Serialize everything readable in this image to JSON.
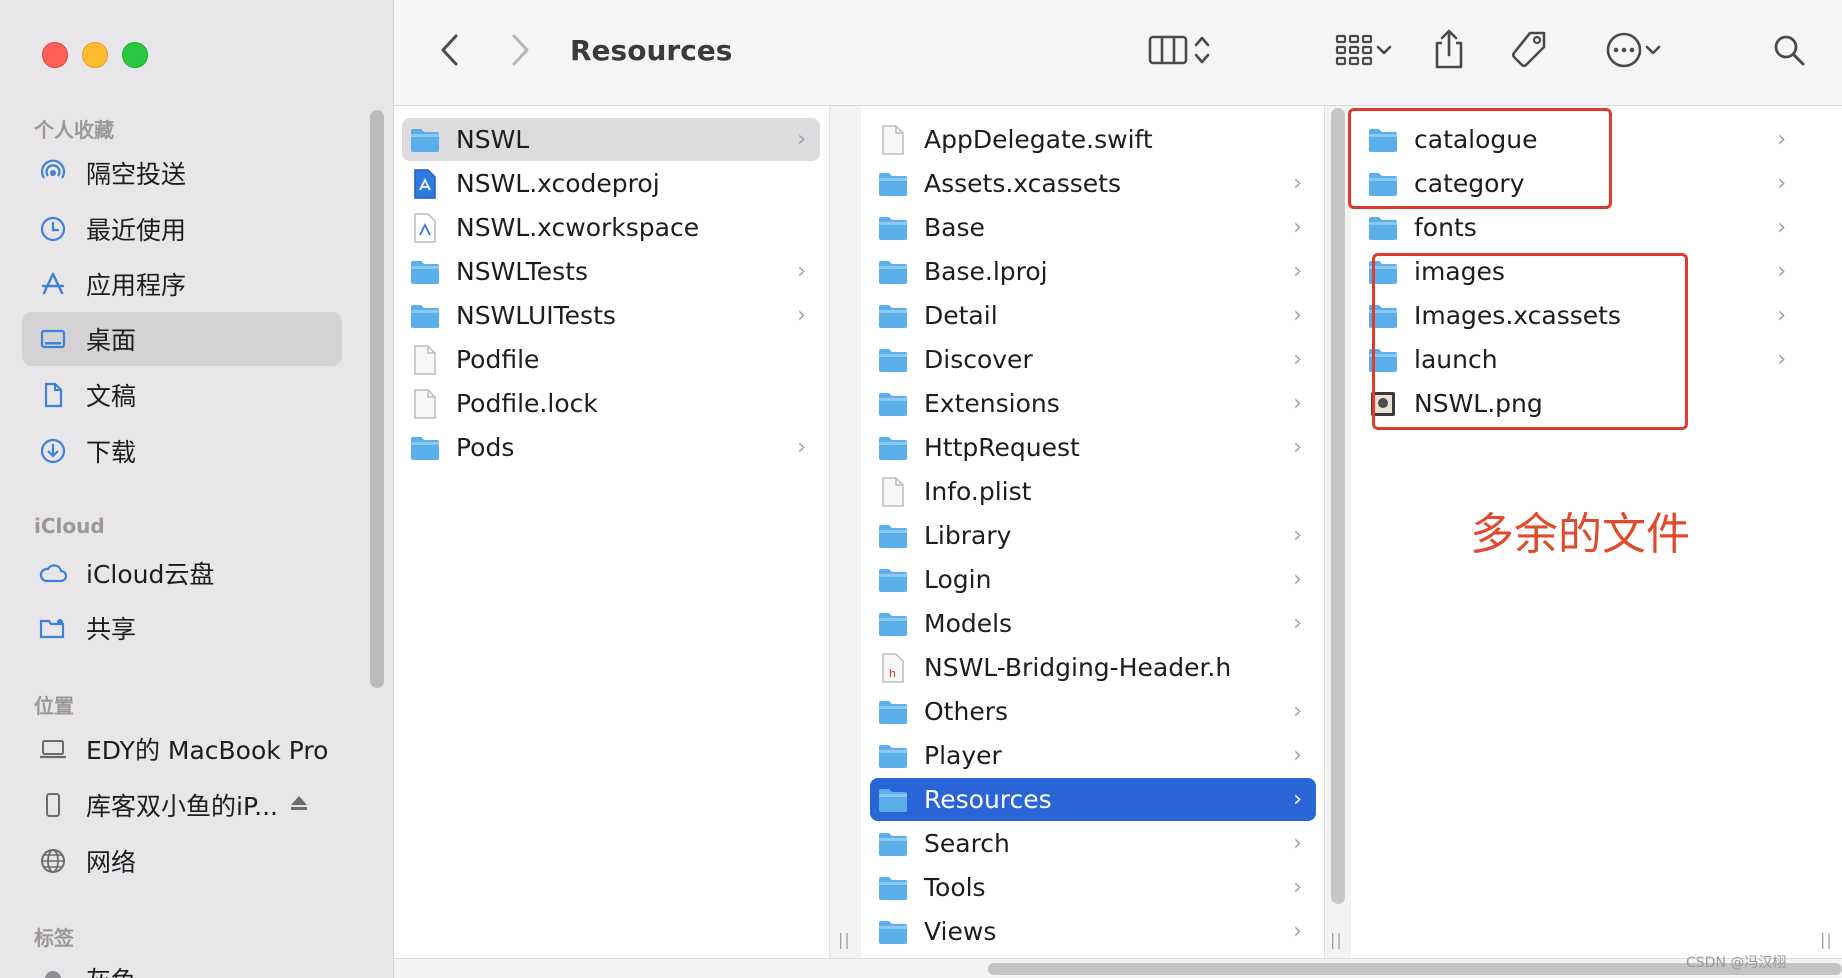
{
  "toolbar": {
    "title": "Resources"
  },
  "sidebar": {
    "sections": {
      "favorites": "个人收藏",
      "icloud": "iCloud",
      "locations": "位置",
      "tags": "标签"
    },
    "favorites": [
      "隔空投送",
      "最近使用",
      "应用程序",
      "桌面",
      "文稿",
      "下载"
    ],
    "icloud": [
      "iCloud云盘",
      "共享"
    ],
    "locations": [
      "EDY的 MacBook Pro",
      "库客双小鱼的iP...",
      "网络"
    ],
    "tags": [
      "灰色"
    ]
  },
  "column1": [
    {
      "name": "NSWL",
      "type": "folder",
      "chevron": true,
      "selected": "gray"
    },
    {
      "name": "NSWL.xcodeproj",
      "type": "xcodeproj",
      "chevron": false
    },
    {
      "name": "NSWL.xcworkspace",
      "type": "xcworkspace",
      "chevron": false
    },
    {
      "name": "NSWLTests",
      "type": "folder",
      "chevron": true
    },
    {
      "name": "NSWLUITests",
      "type": "folder",
      "chevron": true
    },
    {
      "name": "Podfile",
      "type": "file",
      "chevron": false
    },
    {
      "name": "Podfile.lock",
      "type": "file",
      "chevron": false
    },
    {
      "name": "Pods",
      "type": "folder",
      "chevron": true
    }
  ],
  "column2": [
    {
      "name": "AppDelegate.swift",
      "type": "file",
      "chevron": false
    },
    {
      "name": "Assets.xcassets",
      "type": "folder",
      "chevron": true
    },
    {
      "name": "Base",
      "type": "folder",
      "chevron": true
    },
    {
      "name": "Base.lproj",
      "type": "folder",
      "chevron": true
    },
    {
      "name": "Detail",
      "type": "folder",
      "chevron": true
    },
    {
      "name": "Discover",
      "type": "folder",
      "chevron": true
    },
    {
      "name": "Extensions",
      "type": "folder",
      "chevron": true
    },
    {
      "name": "HttpRequest",
      "type": "folder",
      "chevron": true
    },
    {
      "name": "Info.plist",
      "type": "file",
      "chevron": false
    },
    {
      "name": "Library",
      "type": "folder",
      "chevron": true
    },
    {
      "name": "Login",
      "type": "folder",
      "chevron": true
    },
    {
      "name": "Models",
      "type": "folder",
      "chevron": true
    },
    {
      "name": "NSWL-Bridging-Header.h",
      "type": "header",
      "chevron": false
    },
    {
      "name": "Others",
      "type": "folder",
      "chevron": true
    },
    {
      "name": "Player",
      "type": "folder",
      "chevron": true
    },
    {
      "name": "Resources",
      "type": "folder",
      "chevron": true,
      "selected": "blue"
    },
    {
      "name": "Search",
      "type": "folder",
      "chevron": true
    },
    {
      "name": "Tools",
      "type": "folder",
      "chevron": true
    },
    {
      "name": "Views",
      "type": "folder",
      "chevron": true
    }
  ],
  "column3": [
    {
      "name": "catalogue",
      "type": "folder",
      "chevron": true
    },
    {
      "name": "category",
      "type": "folder",
      "chevron": true
    },
    {
      "name": "fonts",
      "type": "folder",
      "chevron": true
    },
    {
      "name": "images",
      "type": "folder",
      "chevron": true
    },
    {
      "name": "Images.xcassets",
      "type": "folder",
      "chevron": true
    },
    {
      "name": "launch",
      "type": "folder",
      "chevron": true
    },
    {
      "name": "NSWL.png",
      "type": "image",
      "chevron": false
    }
  ],
  "annotation": {
    "text": "多余的文件",
    "color": "#e24a2e"
  },
  "watermark": "CSDN @冯汉栩",
  "colors": {
    "folder": "#5aaeea",
    "folder_tab": "#8ccaf5",
    "selection": "#2a65d8",
    "highlight_box": "#e03a2a"
  }
}
